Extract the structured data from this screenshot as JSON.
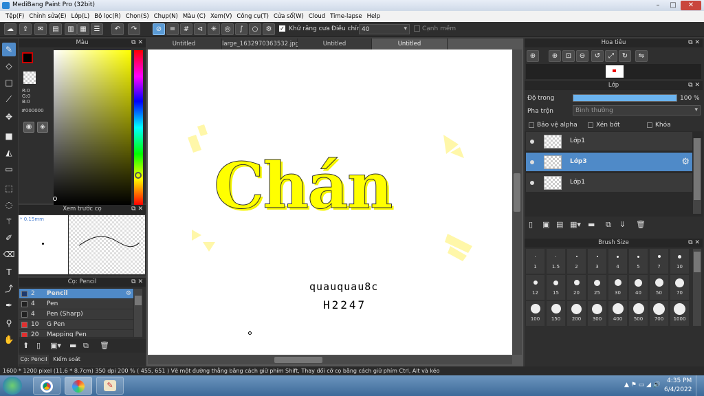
{
  "window": {
    "title": "MediBang Paint Pro (32bit)"
  },
  "menu": [
    "Tệp(F)",
    "Chỉnh sửa(E)",
    "Lớp(L)",
    "Bộ lọc(R)",
    "Chọn(S)",
    "Chụp(N)",
    "Màu (C)",
    "Xem(V)",
    "Công cụ(T)",
    "Cửa sổ(W)",
    "Cloud",
    "Time-lapse",
    "Help"
  ],
  "toolbar": {
    "antialias_label": "Khử răng cưa",
    "adjust_label": "Điều chỉnh",
    "adjust_value": "40",
    "edge_label": "Cạnh mềm"
  },
  "color_panel": {
    "title": "Màu",
    "r": "R:0",
    "g": "G:0",
    "b": "B:0",
    "hex": "#000000"
  },
  "preview_panel": {
    "title": "Xem trước cọ",
    "size": "0.15mm"
  },
  "brush_panel": {
    "title": "Cọ: Pencil",
    "items": [
      {
        "size": "2",
        "name": "Pencil",
        "color": "#1e3a6e"
      },
      {
        "size": "4",
        "name": "Pen",
        "color": "#222222"
      },
      {
        "size": "4",
        "name": "Pen (Sharp)",
        "color": "#222222"
      },
      {
        "size": "10",
        "name": "G Pen",
        "color": "#e03030"
      },
      {
        "size": "20",
        "name": "Mapping Pen",
        "color": "#e03030"
      }
    ],
    "tabs": [
      "Cọ: Pencil",
      "Kiểm soát cọ"
    ]
  },
  "canvas_tabs": [
    "Untitled",
    "large_1632970363532.jpg",
    "Untitled",
    "Untitled"
  ],
  "canvas_art": {
    "word": "Chán",
    "line1": "quauquau8c",
    "line2": "H2247"
  },
  "navigator": {
    "title": "Hoa tiêu"
  },
  "layer_panel": {
    "title": "Lớp",
    "opacity_label": "Độ trong",
    "opacity_value": "100 %",
    "opacity": 1.0,
    "blend_label": "Pha trộn",
    "blend_value": "Bình thường",
    "protect_alpha": "Bảo vệ alpha",
    "clipping": "Xén bớt",
    "lock": "Khóa",
    "layers": [
      {
        "name": "Lớp1",
        "selected": false
      },
      {
        "name": "Lớp3",
        "selected": true
      },
      {
        "name": "Lớp1",
        "selected": false
      }
    ]
  },
  "brush_size_panel": {
    "title": "Brush Size",
    "sizes": [
      "1",
      "1.5",
      "2",
      "3",
      "4",
      "5",
      "7",
      "10",
      "12",
      "15",
      "20",
      "25",
      "30",
      "40",
      "50",
      "70",
      "100",
      "150",
      "200",
      "300",
      "400",
      "500",
      "700",
      "1000"
    ]
  },
  "status": {
    "text": "1600 * 1200 pixel   (11.6 * 8.7cm)   350 dpi   200 %   ( 455, 651 )   Vẽ một đường thẳng bằng cách giữ phím Shift, Thay đổi cỡ cọ bằng cách giữ phím Ctrl, Alt và kéo"
  },
  "taskbar": {
    "time": "4:35 PM",
    "date": "6/4/2022"
  },
  "colors": {
    "accent": "#4f8ac8",
    "yellow": "#ffff00"
  }
}
